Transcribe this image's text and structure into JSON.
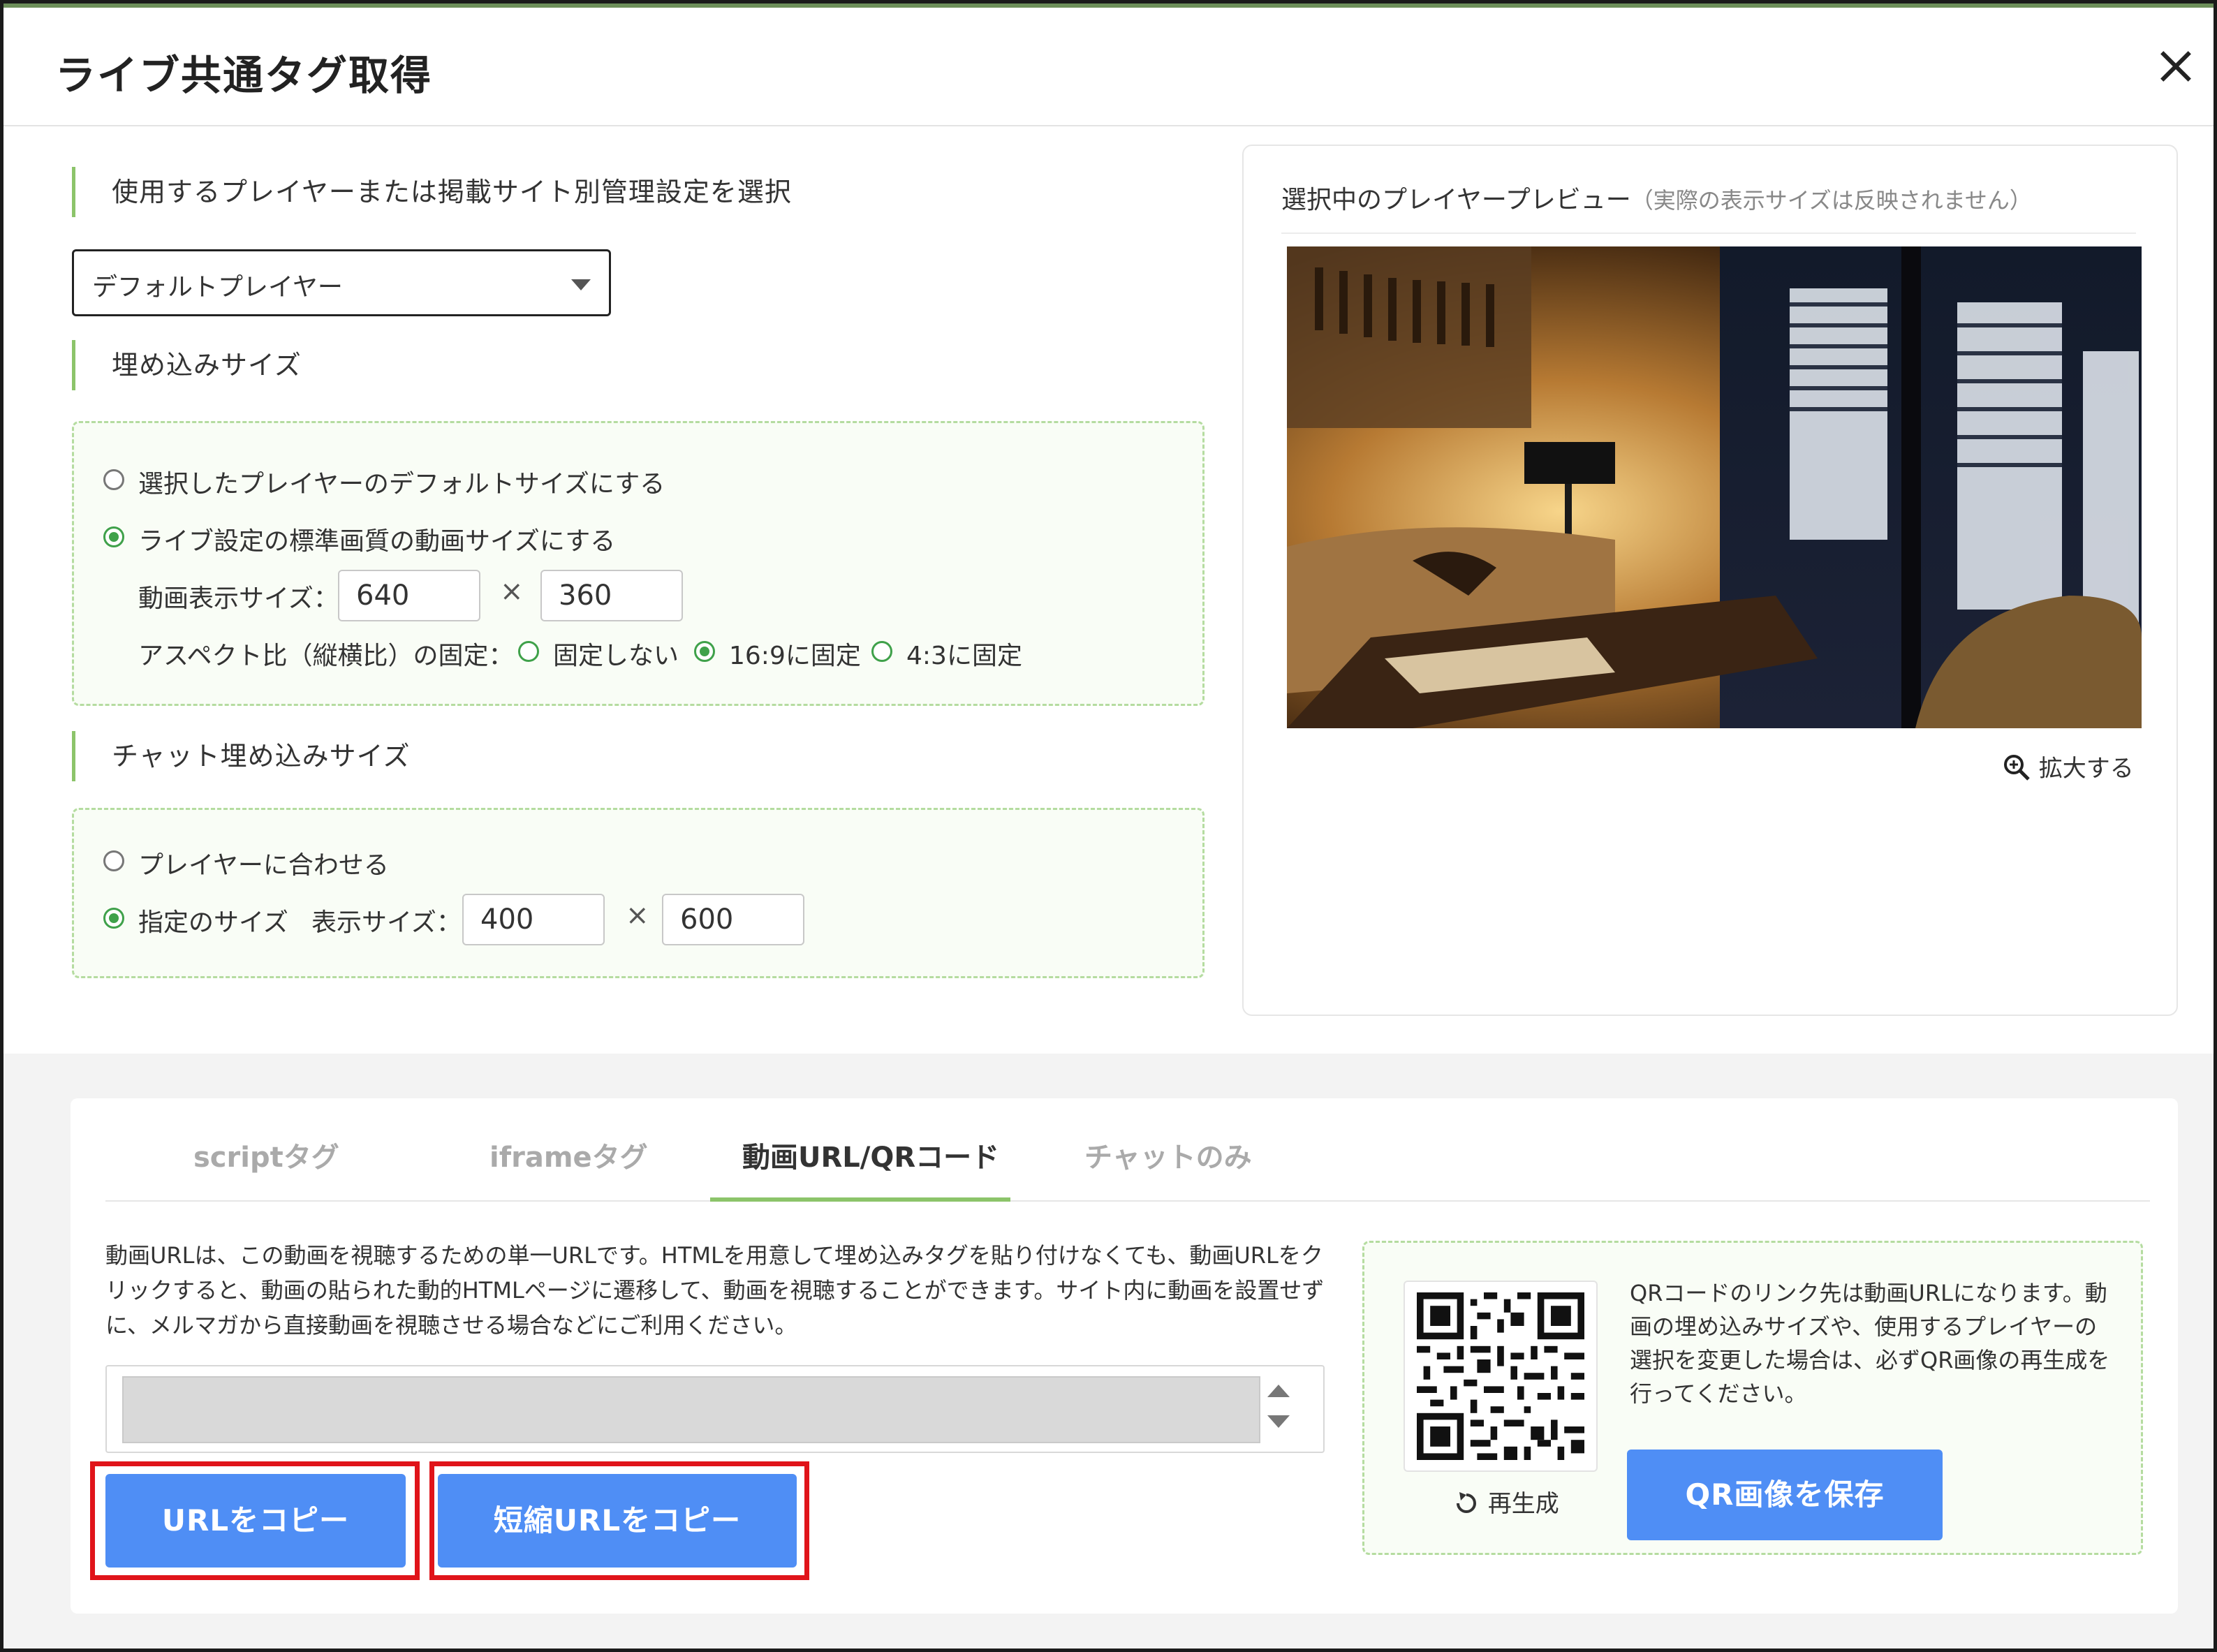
{
  "dialog": {
    "title": "ライブ共通タグ取得",
    "close_icon": "close-icon"
  },
  "player_select": {
    "section_label": "使用するプレイヤーまたは掲載サイト別管理設定を選択",
    "selected": "デフォルトプレイヤー"
  },
  "embed_size": {
    "section_label": "埋め込みサイズ",
    "option_default": "選択したプレイヤーのデフォルトサイズにする",
    "option_standard": "ライブ設定の標準画質の動画サイズにする",
    "display_size_label": "動画表示サイズ：",
    "width": "640",
    "height": "360",
    "times": "×",
    "aspect_label": "アスペクト比（縦横比）の固定：",
    "aspect_none": "固定しない",
    "aspect_169": "16:9に固定",
    "aspect_43": "4:3に固定",
    "selected_option": "standard",
    "selected_aspect": "16:9"
  },
  "chat_size": {
    "section_label": "チャット埋め込みサイズ",
    "option_fit": "プレイヤーに合わせる",
    "option_custom": "指定のサイズ",
    "display_size_label": "表示サイズ：",
    "width": "400",
    "height": "600",
    "times": "×",
    "selected_option": "custom"
  },
  "preview": {
    "title": "選択中のプレイヤープレビュー",
    "note": "（実際の表示サイズは反映されません）",
    "zoom_label": "拡大する"
  },
  "tabs": [
    {
      "label": "scriptタグ",
      "active": false
    },
    {
      "label": "iframeタグ",
      "active": false
    },
    {
      "label": "動画URL/QRコード",
      "active": true
    },
    {
      "label": "チャットのみ",
      "active": false
    }
  ],
  "url_panel": {
    "description": "動画URLは、この動画を視聴するための単一URLです。HTMLを用意して埋め込みタグを貼り付けなくても、動画URLをクリックすると、動画の貼られた動的HTMLページに遷移して、動画を視聴することができます。サイト内に動画を設置せずに、メルマガから直接動画を視聴させる場合などにご利用ください。",
    "url_value": "",
    "copy_url_button": "URLをコピー",
    "copy_short_url_button": "短縮URLをコピー"
  },
  "qr_panel": {
    "regenerate_label": "再生成",
    "info_text": "QRコードのリンク先は動画URLになります。動画の埋め込みサイズや、使用するプレイヤーの選択を変更した場合は、必ずQR画像の再生成を行ってください。",
    "save_button": "QR画像を保存"
  },
  "colors": {
    "accent_green": "#8cc46a",
    "radio_green": "#3fa14a",
    "button_blue": "#4f8ef5",
    "highlight_red": "#e0141a"
  }
}
